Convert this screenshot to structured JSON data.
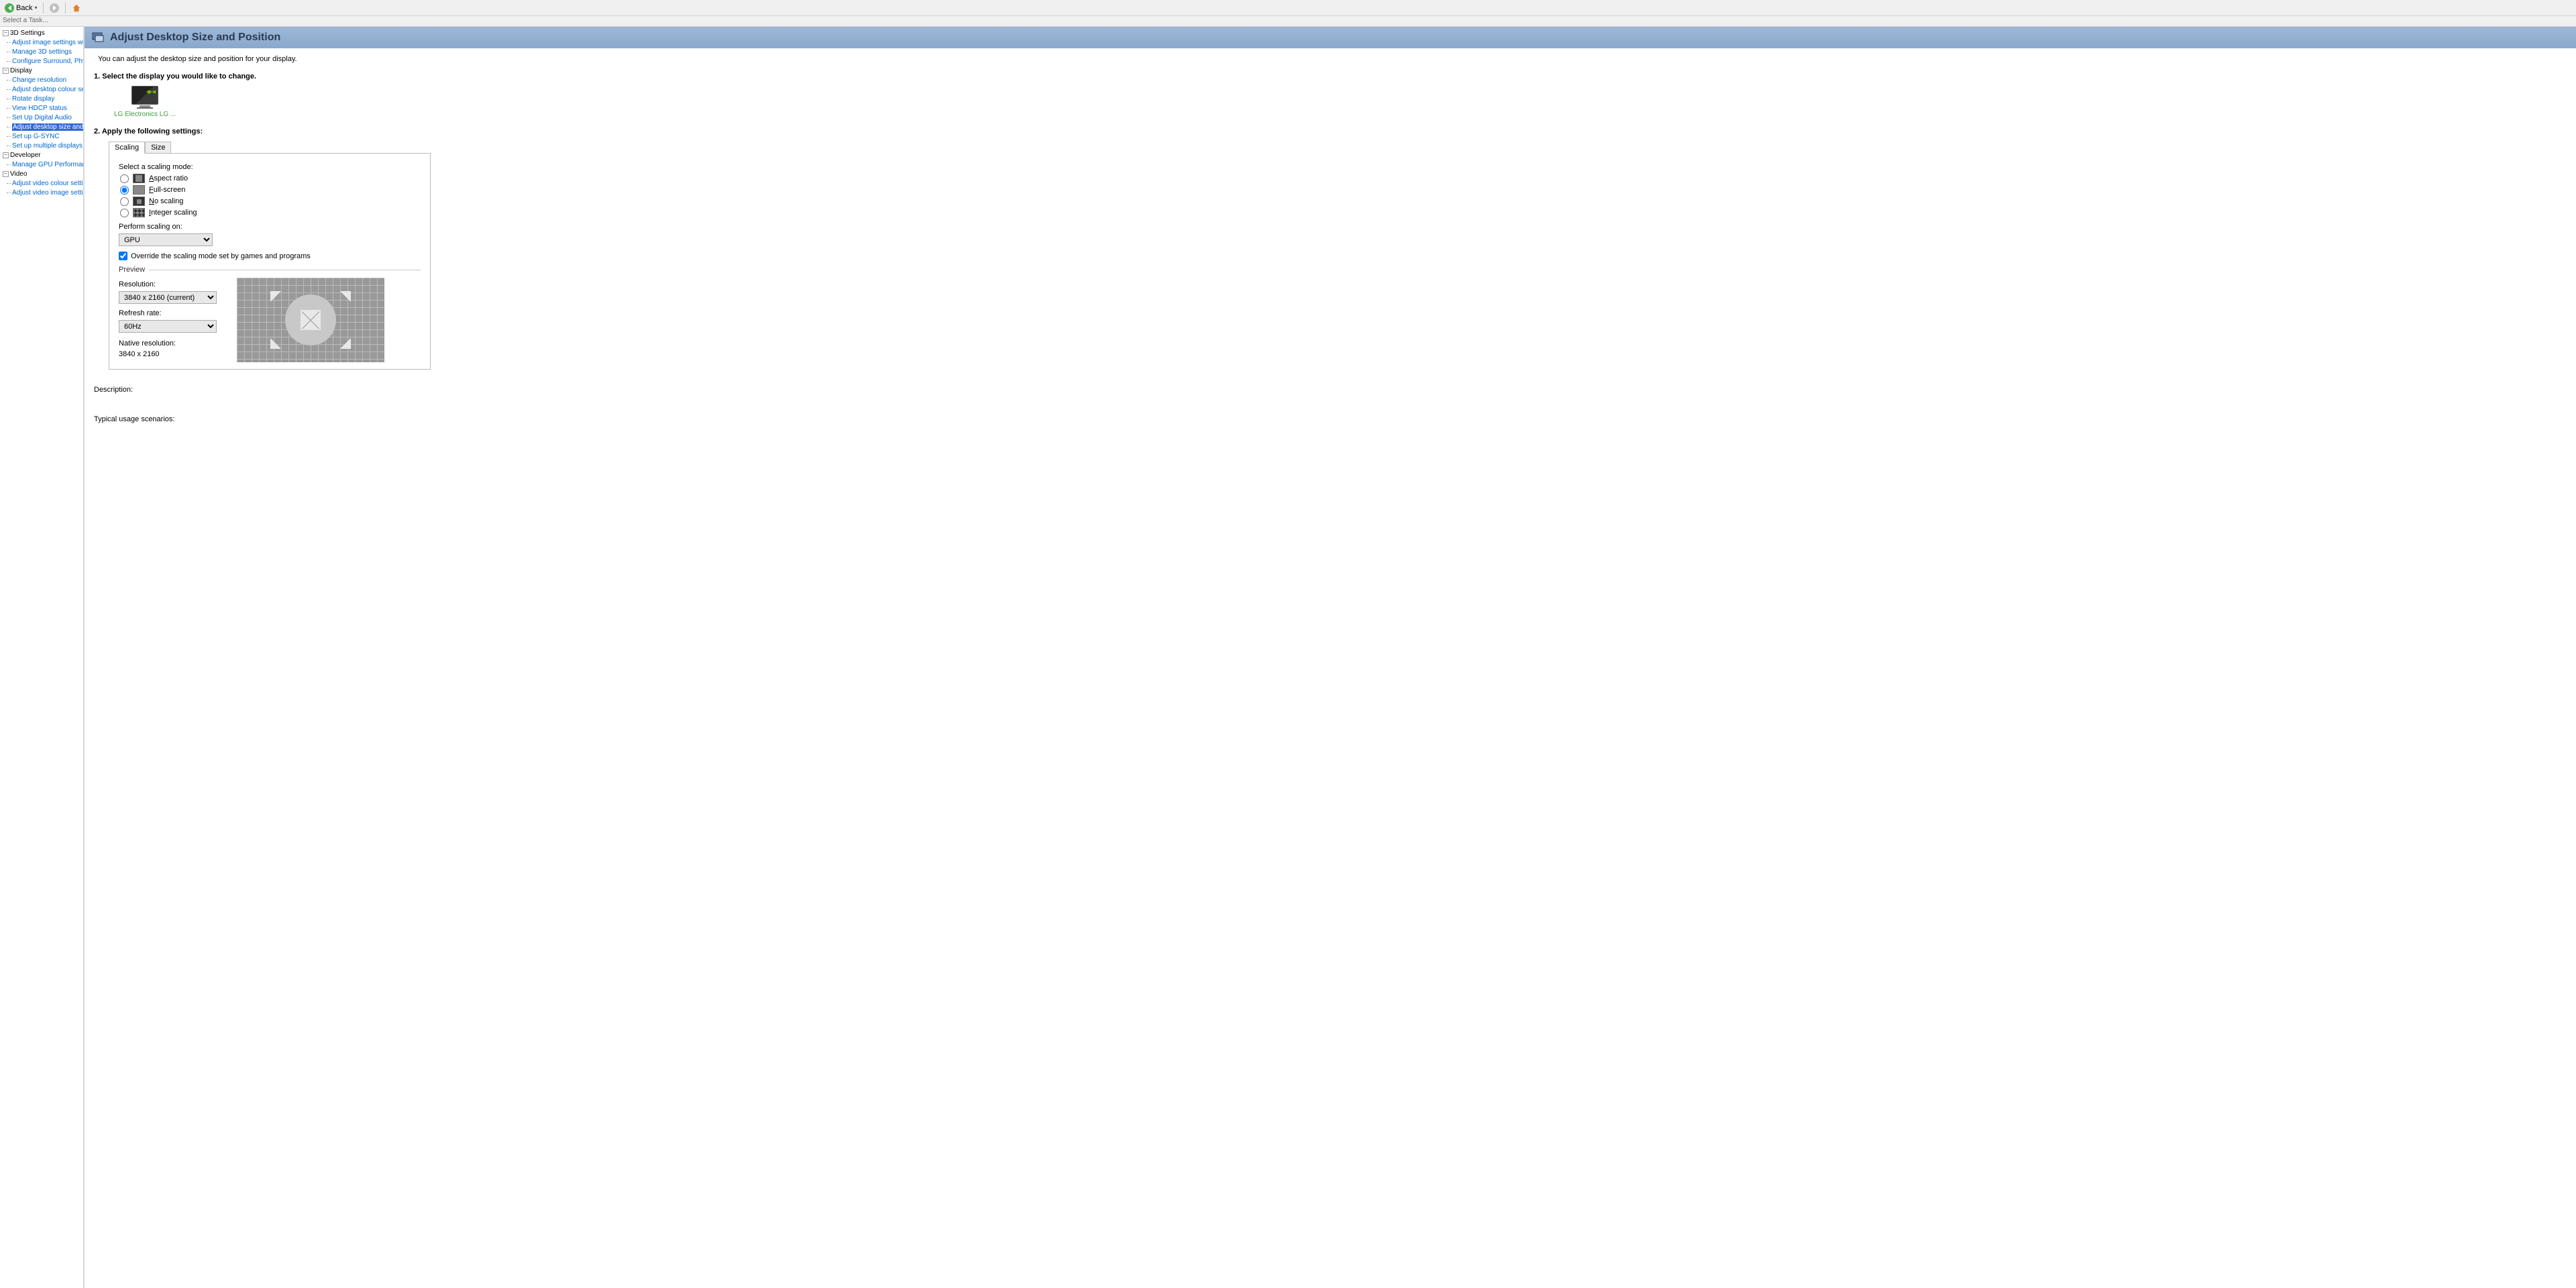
{
  "toolbar": {
    "back_label": "Back",
    "search_placeholder": "Select a Task..."
  },
  "tree": {
    "cat_3d": "3D Settings",
    "c_3d_1": "Adjust image settings with preview",
    "c_3d_2": "Manage 3D settings",
    "c_3d_3": "Configure Surround, PhysX",
    "cat_display": "Display",
    "c_d_1": "Change resolution",
    "c_d_2": "Adjust desktop colour settings",
    "c_d_3": "Rotate display",
    "c_d_4": "View HDCP status",
    "c_d_5": "Set Up Digital Audio",
    "c_d_6": "Adjust desktop size and position",
    "c_d_7": "Set up G-SYNC",
    "c_d_8": "Set up multiple displays",
    "cat_dev": "Developer",
    "c_dev_1": "Manage GPU Performance Counters",
    "cat_video": "Video",
    "c_v_1": "Adjust video colour settings",
    "c_v_2": "Adjust video image settings"
  },
  "page": {
    "title": "Adjust Desktop Size and Position",
    "intro": "You can adjust the desktop size and position for your display.",
    "step1": "1. Select the display you would like to change.",
    "display_name": "LG Electronics LG ...",
    "step2": "2. Apply the following settings:",
    "tab_scaling": "Scaling",
    "tab_size": "Size",
    "scaling_mode_label": "Select a scaling mode:",
    "mode_aspect": "spect ratio",
    "mode_aspect_u": "A",
    "mode_full": "ull-screen",
    "mode_full_u": "F",
    "mode_none": "o scaling",
    "mode_none_u": "N",
    "mode_int": "nteger scaling",
    "mode_int_u": "I",
    "perform_label": "Perform scaling on:",
    "perform_value": "GPU",
    "override_label": "Override the scaling mode set by games and programs",
    "preview_label": "Preview",
    "res_label": "Resolution:",
    "res_value": "3840 x 2160 (current)",
    "refresh_label": "Refresh rate:",
    "refresh_value": "60Hz",
    "native_label": "Native resolution:",
    "native_value": "3840 x 2160",
    "desc_label": "Description:",
    "usage_label": "Typical usage scenarios:"
  }
}
